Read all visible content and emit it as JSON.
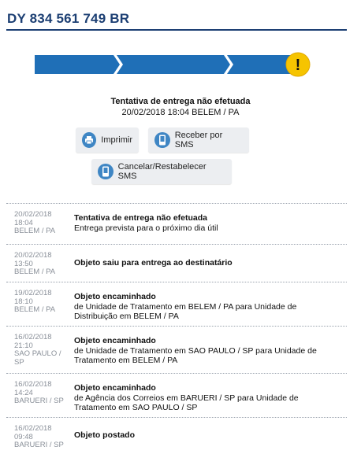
{
  "header": {
    "tracking_code": "DY 834 561 749 BR"
  },
  "progress": {
    "completed_steps": 3,
    "total_steps": 4,
    "bar_color": "#1f6fb7",
    "alert_color": "#f6c400",
    "alert_icon": "exclamation-icon",
    "alert_symbol": "!"
  },
  "status": {
    "title": "Tentativa de entrega não efetuada",
    "datetime_location": "20/02/2018 18:04 BELEM / PA"
  },
  "actions": {
    "print_label": "Imprimir",
    "sms_label": "Receber por SMS",
    "cancel_sms_label": "Cancelar/Restabelecer SMS",
    "print_icon": "printer-icon",
    "phone_icon": "phone-icon"
  },
  "events": [
    {
      "date": "20/02/2018",
      "time": "18:04",
      "location": "BELEM / PA",
      "title": "Tentativa de entrega não efetuada",
      "detail": "Entrega prevista para o próximo dia útil"
    },
    {
      "date": "20/02/2018",
      "time": "13:50",
      "location": "BELEM / PA",
      "title": "Objeto saiu para entrega ao destinatário",
      "detail": ""
    },
    {
      "date": "19/02/2018",
      "time": "18:10",
      "location": "BELEM / PA",
      "title": "Objeto encaminhado",
      "detail": "de Unidade de Tratamento em BELEM / PA para Unidade de Distribuição em BELEM / PA"
    },
    {
      "date": "16/02/2018",
      "time": "21:10",
      "location": "SAO PAULO / SP",
      "title": "Objeto encaminhado",
      "detail": "de Unidade de Tratamento em SAO PAULO / SP para Unidade de Tratamento em BELEM / PA"
    },
    {
      "date": "16/02/2018",
      "time": "14:24",
      "location": "BARUERI / SP",
      "title": "Objeto encaminhado",
      "detail": "de Agência dos Correios em BARUERI / SP para Unidade de Tratamento em SAO PAULO / SP"
    },
    {
      "date": "16/02/2018",
      "time": "09:48",
      "location": "BARUERI / SP",
      "title": "Objeto postado",
      "detail": ""
    }
  ]
}
